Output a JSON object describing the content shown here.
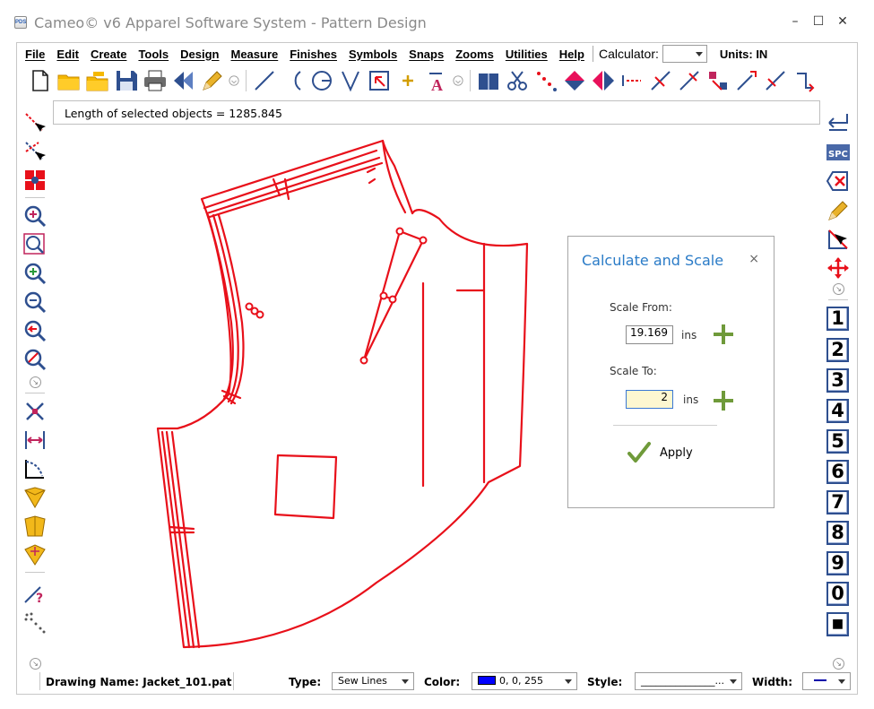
{
  "window": {
    "app_icon_text": "PDS",
    "title": "Cameo© v6 Apparel Software System - Pattern Design",
    "minimize": "–",
    "maximize": "☐",
    "close": "✕"
  },
  "menubar": {
    "items": [
      "File",
      "Edit",
      "Create",
      "Tools",
      "Design",
      "Measure",
      "Finishes",
      "Symbols",
      "Snaps",
      "Zooms",
      "Utilities",
      "Help"
    ],
    "calculator_label": "Calculator:",
    "calculator_value": "",
    "units": "Units: IN"
  },
  "infobox": {
    "message": "Length of selected objects = 1285.845"
  },
  "toolbar": {
    "icons": [
      "new-file-icon",
      "open-folder-icon",
      "open-multiple-icon",
      "save-icon",
      "print-icon",
      "undo-icon",
      "pencil-icon",
      "more-icon",
      "line-icon",
      "arc-icon",
      "circle-icon",
      "v-dart-icon",
      "select-rect-icon",
      "point-icon",
      "text-icon",
      "more-icon",
      "book-icon",
      "cut-icon",
      "dots-line-icon",
      "mirror-vertical-icon",
      "mirror-horizontal-icon",
      "dashed-line-icon",
      "cross-line-icon",
      "cross-line-2-icon",
      "grade-point-icon",
      "extend-icon",
      "slash-icon",
      "return-icon"
    ]
  },
  "right_toolbar": {
    "numbers": [
      "1",
      "2",
      "3",
      "4",
      "5",
      "6",
      "7",
      "8",
      "9",
      "0",
      "■"
    ],
    "spc_label": "SPC"
  },
  "dialog": {
    "title": "Calculate and Scale",
    "close": "×",
    "scale_from_label": "Scale From:",
    "scale_from_value": "19.169",
    "scale_from_unit": "ins",
    "scale_to_label": "Scale To:",
    "scale_to_value": "2",
    "scale_to_unit": "ins",
    "apply_label": "Apply"
  },
  "statusbar": {
    "drawing_name": "Drawing Name: Jacket_101.pat",
    "type_label": "Type:",
    "type_value": "Sew Lines",
    "color_label": "Color:",
    "color_value": "0, 0, 255",
    "color_swatch": "#0000ff",
    "style_label": "Style:",
    "style_value": "_______________...",
    "width_label": "Width:"
  },
  "colors": {
    "pattern": "#e8101a",
    "accent": "#2a7bc7",
    "apply_check": "#6f9a3a"
  }
}
